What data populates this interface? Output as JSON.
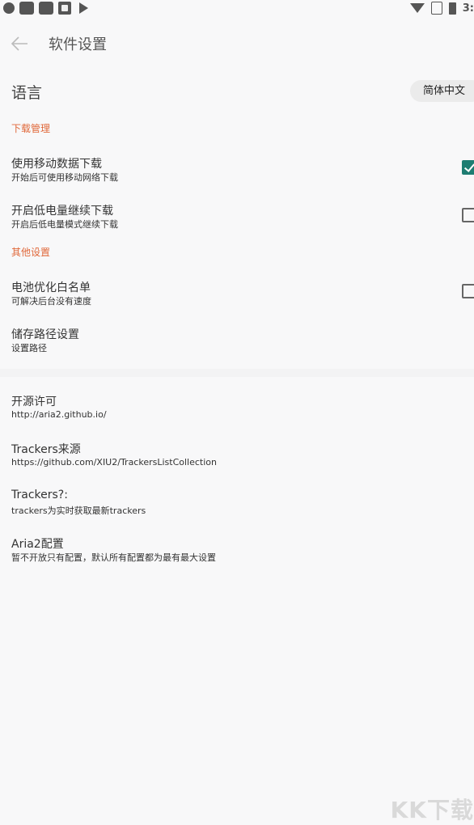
{
  "status_bar": {
    "time": "3:",
    "icons": [
      "notification-dot-icon",
      "app-square-icon",
      "app-square-icon",
      "font-icon",
      "play-store-icon",
      "wifi-icon",
      "no-sim-icon",
      "battery-icon"
    ]
  },
  "toolbar": {
    "title": "软件设置",
    "back_icon": "arrow-left-icon"
  },
  "language": {
    "label": "语言",
    "value": "简体中文"
  },
  "sections": {
    "download": {
      "header": "下载管理",
      "mobile_data": {
        "title": "使用移动数据下载",
        "subtitle": "开始后可使用移动网络下载",
        "checked": true
      },
      "low_battery": {
        "title": "开启低电量继续下载",
        "subtitle": "开启后低电量模式继续下载",
        "checked": false
      }
    },
    "other": {
      "header": "其他设置",
      "battery_whitelist": {
        "title": "电池优化白名单",
        "subtitle": "可解决后台没有速度",
        "checked": false
      },
      "storage_path": {
        "title": "储存路径设置",
        "subtitle": "设置路径"
      }
    },
    "about": {
      "license": {
        "title": "开源许可",
        "subtitle": "http://aria2.github.io/"
      },
      "trackers_source": {
        "title": "Trackers来源",
        "subtitle": "https://github.com/XIU2/TrackersListCollection"
      },
      "trackers_help": {
        "title": "Trackers?:",
        "subtitle": "trackers为实时获取最新trackers"
      },
      "aria2_config": {
        "title": "Aria2配置",
        "subtitle": "暂不开放只有配置，默认所有配置都为最有最大设置"
      }
    }
  },
  "colors": {
    "accent": "#e0683a",
    "checkbox_checked": "#1e7d72",
    "background": "#f8f8f9"
  },
  "watermark": "KK下载"
}
